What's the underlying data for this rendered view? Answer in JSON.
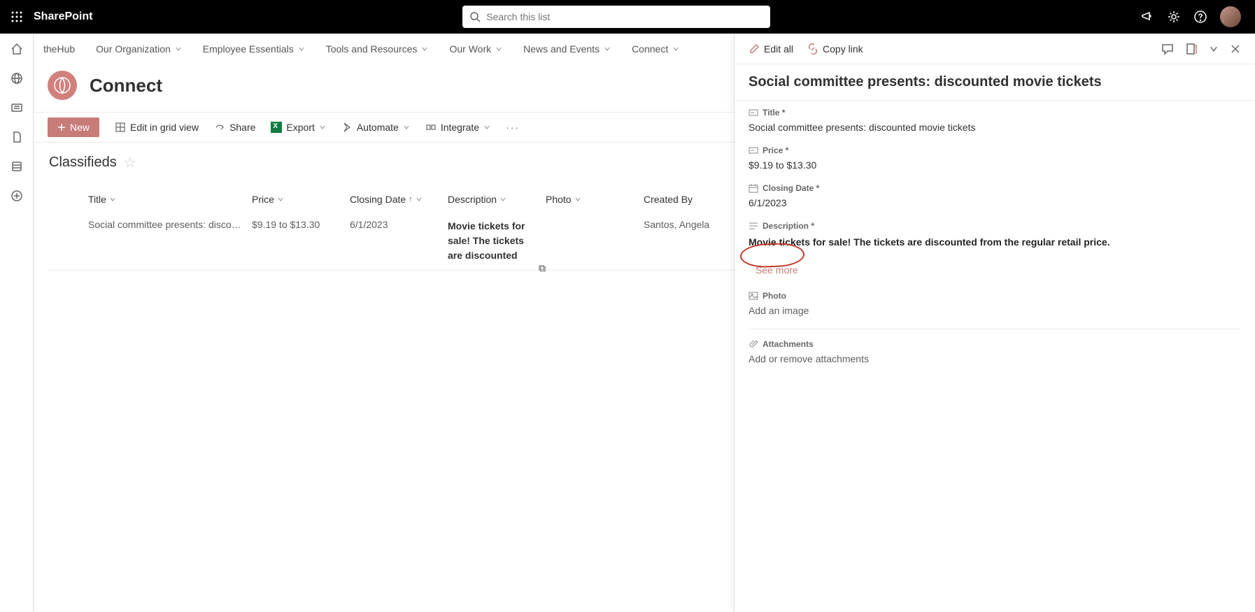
{
  "app": {
    "name": "SharePoint"
  },
  "search": {
    "placeholder": "Search this list"
  },
  "hubnav": [
    {
      "label": "theHub",
      "hasChevron": false
    },
    {
      "label": "Our Organization",
      "hasChevron": true
    },
    {
      "label": "Employee Essentials",
      "hasChevron": true
    },
    {
      "label": "Tools and Resources",
      "hasChevron": true
    },
    {
      "label": "Our Work",
      "hasChevron": true
    },
    {
      "label": "News and Events",
      "hasChevron": true
    },
    {
      "label": "Connect",
      "hasChevron": true
    }
  ],
  "site": {
    "name": "Connect"
  },
  "commands": {
    "new": "New",
    "editGrid": "Edit in grid view",
    "share": "Share",
    "export": "Export",
    "automate": "Automate",
    "integrate": "Integrate"
  },
  "list": {
    "title": "Classifieds",
    "columns": {
      "title": "Title",
      "price": "Price",
      "closing": "Closing Date",
      "description": "Description",
      "photo": "Photo",
      "createdBy": "Created By"
    },
    "rows": [
      {
        "title": "Social committee presents: discounted mov...",
        "price": "$9.19 to $13.30",
        "closing": "6/1/2023",
        "description": "Movie tickets for sale!  The tickets are discounted",
        "photo": "",
        "createdBy": "Santos, Angela"
      }
    ]
  },
  "panel": {
    "editAll": "Edit all",
    "copyLink": "Copy link",
    "title": "Social committee presents: discounted movie tickets",
    "fields": {
      "titleLabel": "Title *",
      "titleValue": "Social committee presents: discounted movie tickets",
      "priceLabel": "Price *",
      "priceValue": "$9.19 to $13.30",
      "closingLabel": "Closing Date *",
      "closingValue": "6/1/2023",
      "descLabel": "Description *",
      "descValue": "Movie tickets for sale!  The tickets are discounted from the regular retail price.",
      "seeMore": "See more",
      "photoLabel": "Photo",
      "addImage": "Add an image",
      "attachmentsLabel": "Attachments",
      "attachmentsAction": "Add or remove attachments"
    }
  }
}
